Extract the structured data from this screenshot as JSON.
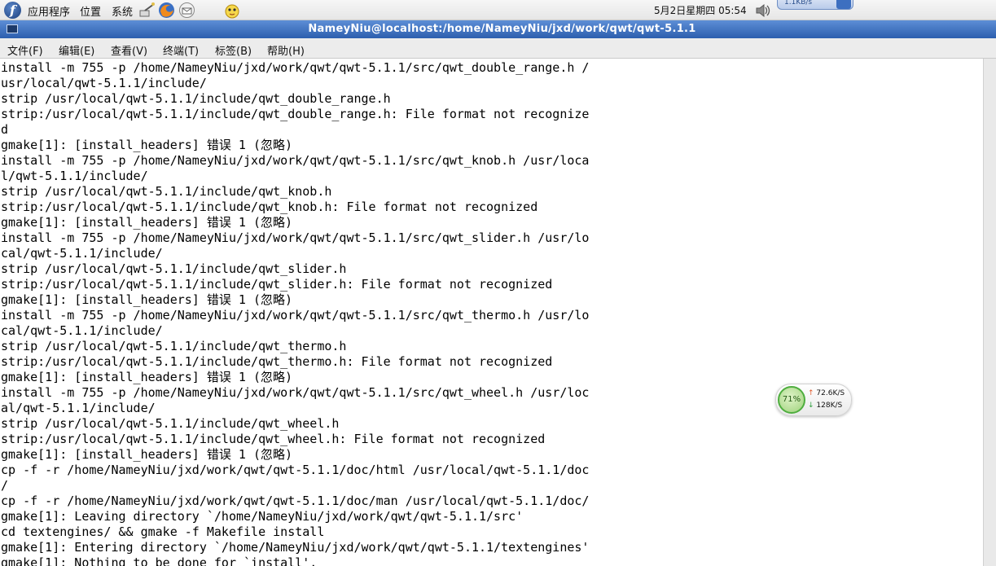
{
  "panel": {
    "menus": [
      "应用程序",
      "位置",
      "系统"
    ],
    "clock": "5月2日星期四 05:54",
    "net_widget": "1.1KB/s"
  },
  "window": {
    "title": "NameyNiu@localhost:/home/NameyNiu/jxd/work/qwt/qwt-5.1.1"
  },
  "menu_bar": {
    "items": [
      "文件(F)",
      "编辑(E)",
      "查看(V)",
      "终端(T)",
      "标签(B)",
      "帮助(H)"
    ]
  },
  "terminal": {
    "lines": [
      "install -m 755 -p /home/NameyNiu/jxd/work/qwt/qwt-5.1.1/src/qwt_double_range.h /",
      "usr/local/qwt-5.1.1/include/",
      "strip /usr/local/qwt-5.1.1/include/qwt_double_range.h",
      "strip:/usr/local/qwt-5.1.1/include/qwt_double_range.h: File format not recognize",
      "d",
      "gmake[1]: [install_headers] 错误 1 (忽略)",
      "install -m 755 -p /home/NameyNiu/jxd/work/qwt/qwt-5.1.1/src/qwt_knob.h /usr/loca",
      "l/qwt-5.1.1/include/",
      "strip /usr/local/qwt-5.1.1/include/qwt_knob.h",
      "strip:/usr/local/qwt-5.1.1/include/qwt_knob.h: File format not recognized",
      "gmake[1]: [install_headers] 错误 1 (忽略)",
      "install -m 755 -p /home/NameyNiu/jxd/work/qwt/qwt-5.1.1/src/qwt_slider.h /usr/lo",
      "cal/qwt-5.1.1/include/",
      "strip /usr/local/qwt-5.1.1/include/qwt_slider.h",
      "strip:/usr/local/qwt-5.1.1/include/qwt_slider.h: File format not recognized",
      "gmake[1]: [install_headers] 错误 1 (忽略)",
      "install -m 755 -p /home/NameyNiu/jxd/work/qwt/qwt-5.1.1/src/qwt_thermo.h /usr/lo",
      "cal/qwt-5.1.1/include/",
      "strip /usr/local/qwt-5.1.1/include/qwt_thermo.h",
      "strip:/usr/local/qwt-5.1.1/include/qwt_thermo.h: File format not recognized",
      "gmake[1]: [install_headers] 错误 1 (忽略)",
      "install -m 755 -p /home/NameyNiu/jxd/work/qwt/qwt-5.1.1/src/qwt_wheel.h /usr/loc",
      "al/qwt-5.1.1/include/",
      "strip /usr/local/qwt-5.1.1/include/qwt_wheel.h",
      "strip:/usr/local/qwt-5.1.1/include/qwt_wheel.h: File format not recognized",
      "gmake[1]: [install_headers] 错误 1 (忽略)",
      "cp -f -r /home/NameyNiu/jxd/work/qwt/qwt-5.1.1/doc/html /usr/local/qwt-5.1.1/doc",
      "/",
      "cp -f -r /home/NameyNiu/jxd/work/qwt/qwt-5.1.1/doc/man /usr/local/qwt-5.1.1/doc/",
      "gmake[1]: Leaving directory `/home/NameyNiu/jxd/work/qwt/qwt-5.1.1/src'",
      "cd textengines/ && gmake -f Makefile install",
      "gmake[1]: Entering directory `/home/NameyNiu/jxd/work/qwt/qwt-5.1.1/textengines'",
      "gmake[1]: Nothing to be done for `install'."
    ]
  },
  "speed_meter": {
    "percent": "71%",
    "upload": "72.6K/S",
    "download": "128K/S"
  },
  "colors": {
    "title_bar": "#2d5fae",
    "terminal_bg": "#ffffff",
    "terminal_fg": "#000000"
  }
}
